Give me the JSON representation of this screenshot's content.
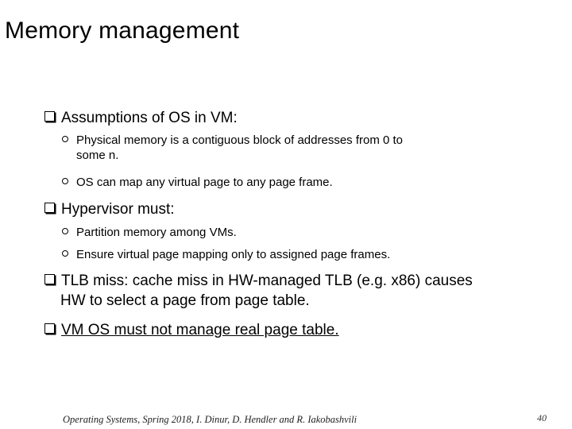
{
  "slide": {
    "title": "Memory management",
    "bullets": [
      {
        "text": "Assumptions of OS in VM:",
        "sub": [
          {
            "line1": "Physical memory is a contiguous block of addresses from 0 to",
            "line2": "some n."
          },
          {
            "line1": "OS can map any virtual page to any page frame."
          }
        ]
      },
      {
        "text": "Hypervisor must:",
        "sub": [
          {
            "line1": "Partition memory among VMs."
          },
          {
            "line1": "Ensure virtual page mapping only to assigned page frames."
          }
        ]
      },
      {
        "line1": "TLB miss: cache miss in HW-managed TLB (e.g. x86) causes",
        "line2": "HW to select a page from page table."
      },
      {
        "text": "VM OS must not manage real page table.",
        "underlined": true
      }
    ],
    "footer": "Operating Systems, Spring 2018, I. Dinur, D. Hendler and R. Iakobashvili",
    "page_number": "40"
  }
}
